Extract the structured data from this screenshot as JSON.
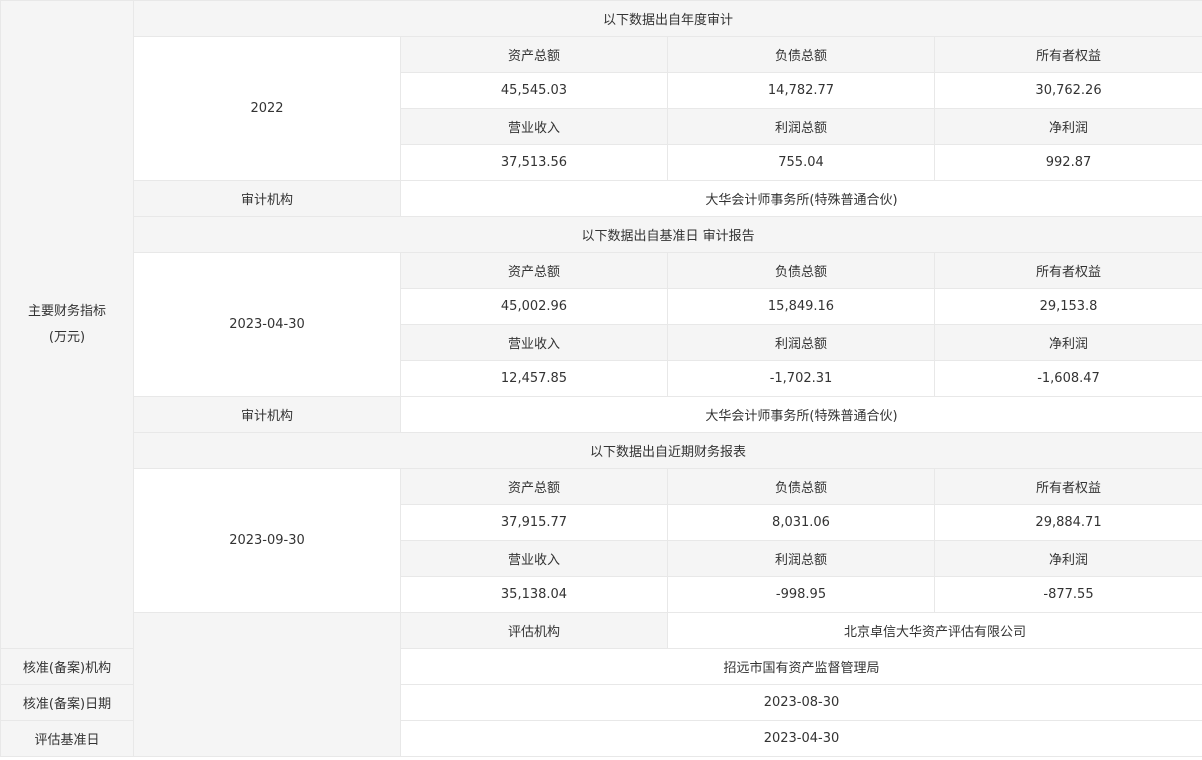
{
  "main_label": "主要财务指标",
  "unit": "(万元)",
  "headers": {
    "assets": "资产总额",
    "liabilities": "负债总额",
    "equity": "所有者权益",
    "revenue": "营业收入",
    "total_profit": "利润总额",
    "net_profit": "净利润"
  },
  "audit_org_label": "审计机构",
  "sections": [
    {
      "title": "以下数据出自年度审计",
      "period": "2022",
      "assets": "45,545.03",
      "liabilities": "14,782.77",
      "equity": "30,762.26",
      "revenue": "37,513.56",
      "total_profit": "755.04",
      "net_profit": "992.87",
      "audit_org": "大华会计师事务所(特殊普通合伙)"
    },
    {
      "title": "以下数据出自基准日 审计报告",
      "period": "2023-04-30",
      "assets": "45,002.96",
      "liabilities": "15,849.16",
      "equity": "29,153.8",
      "revenue": "12,457.85",
      "total_profit": "-1,702.31",
      "net_profit": "-1,608.47",
      "audit_org": "大华会计师事务所(特殊普通合伙)"
    },
    {
      "title": "以下数据出自近期财务报表",
      "period": "2023-09-30",
      "assets": "37,915.77",
      "liabilities": "8,031.06",
      "equity": "29,884.71",
      "revenue": "35,138.04",
      "total_profit": "-998.95",
      "net_profit": "-877.55"
    }
  ],
  "footer": [
    {
      "label": "评估机构",
      "value": "北京卓信大华资产评估有限公司"
    },
    {
      "label": "核准(备案)机构",
      "value": "招远市国有资产监督管理局"
    },
    {
      "label": "核准(备案)日期",
      "value": "2023-08-30"
    },
    {
      "label": "评估基准日",
      "value": "2023-04-30"
    }
  ]
}
